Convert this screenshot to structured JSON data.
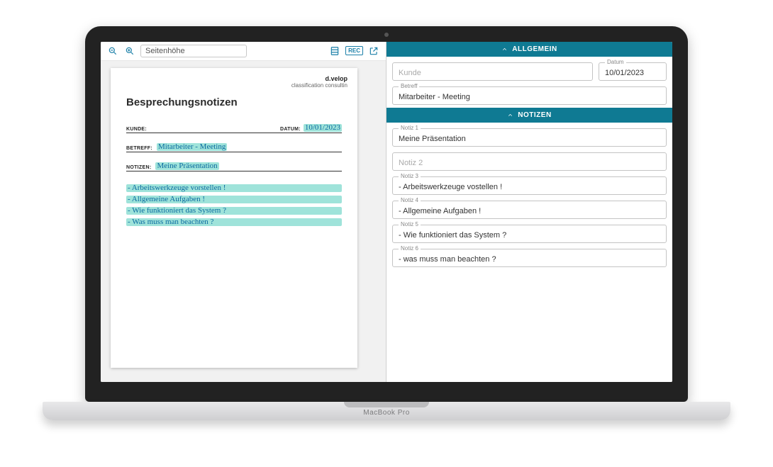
{
  "device": {
    "label": "MacBook Pro"
  },
  "toolbar": {
    "zoom_label": "Seitenhöhe",
    "rec_label": "REC"
  },
  "document": {
    "brand_name": "d.velop",
    "brand_sub": "classification consultin",
    "title": "Besprechungsnotizen",
    "labels": {
      "kunde": "KUNDE:",
      "datum": "DATUM:",
      "betreff": "BETREFF:",
      "notizen": "NOTIZEN:"
    },
    "handwritten": {
      "kunde": "",
      "datum": "10/01/2023",
      "betreff": "Mitarbeiter - Meeting",
      "notizen_head": "Meine Präsentation",
      "bullets": [
        "- Arbeitswerkzeuge vorstellen !",
        "- Allgemeine Aufgaben !",
        "- Wie funktioniert das System ?",
        "- Was muss man beachten ?"
      ]
    }
  },
  "form": {
    "sections": {
      "allgemein": {
        "title": "ALLGEMEIN",
        "fields": {
          "kunde": {
            "legend": "",
            "value": "",
            "placeholder": "Kunde"
          },
          "datum": {
            "legend": "Datum",
            "value": "10/01/2023"
          },
          "betreff": {
            "legend": "Betreff",
            "value": "Mitarbeiter - Meeting"
          }
        }
      },
      "notizen": {
        "title": "NOTIZEN",
        "fields": [
          {
            "legend": "Notiz 1",
            "value": "Meine Präsentation"
          },
          {
            "legend": "",
            "value": "",
            "placeholder": "Notiz 2"
          },
          {
            "legend": "Notiz 3",
            "value": "- Arbeitswerkzeuge vostellen !"
          },
          {
            "legend": "Notiz 4",
            "value": "- Allgemeine Aufgaben !"
          },
          {
            "legend": "Notiz 5",
            "value": "- Wie funktioniert das System ?"
          },
          {
            "legend": "Notiz 6",
            "value": "- was muss man beachten ?"
          }
        ]
      }
    }
  }
}
